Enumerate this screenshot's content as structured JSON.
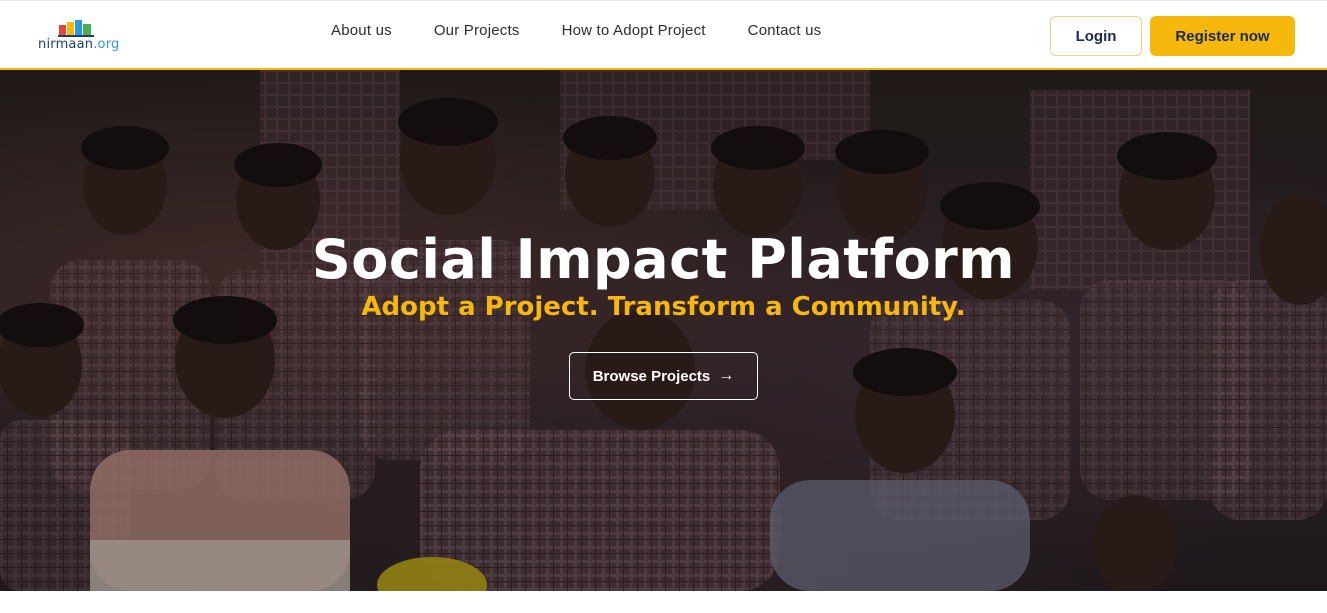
{
  "brand": {
    "name": "nirmaan",
    "tld": ".org"
  },
  "nav": {
    "links": [
      {
        "label": "About us"
      },
      {
        "label": "Our Projects"
      },
      {
        "label": "How to Adopt Project"
      },
      {
        "label": "Contact us"
      }
    ],
    "login_label": "Login",
    "register_label": "Register now"
  },
  "hero": {
    "title": "Social Impact Platform",
    "subtitle": "Adopt a Project. Transform a Community.",
    "cta_label": "Browse Projects",
    "cta_icon": "arrow-right-icon"
  },
  "colors": {
    "accent": "#f6b80c",
    "navy": "#1c2a4a",
    "nav_text": "#2d2d2d",
    "hero_text": "#ffffff"
  }
}
